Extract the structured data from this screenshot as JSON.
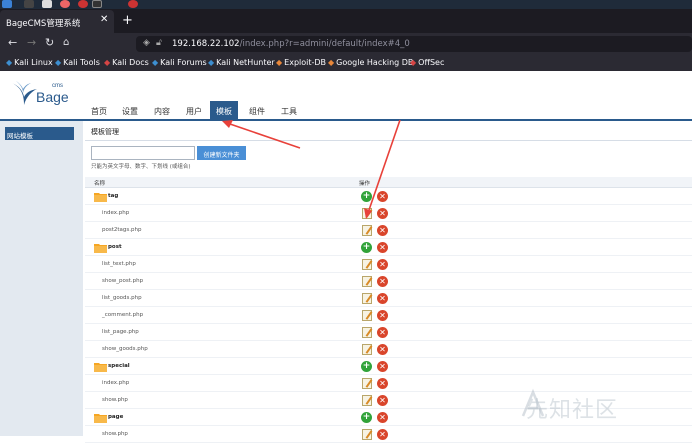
{
  "browser": {
    "tab_title": "BageCMS管理系统",
    "tab_close": "✕",
    "new_tab": "+",
    "url_host": "192.168.22.102",
    "url_path": "/index.php?r=admini/default/index#4_0",
    "bookmarks": [
      "Kali Linux",
      "Kali Tools",
      "Kali Docs",
      "Kali Forums",
      "Kali NetHunter",
      "Exploit-DB",
      "Google Hacking DB",
      "OffSec"
    ]
  },
  "site": {
    "logo_text": "Bage",
    "logo_cms": "cms",
    "nav": [
      "首页",
      "设置",
      "内容",
      "用户",
      "模板",
      "组件",
      "工具"
    ],
    "nav_active_index": 4,
    "sidebar_item": "网站模板"
  },
  "content": {
    "title": "模板管理",
    "create_button": "创建新文件夹",
    "folder_input_value": "",
    "hint": "只能为英文字母、数字、下划线 (或组合)",
    "col_name": "名称",
    "col_op": "操作",
    "rows": [
      {
        "type": "folder",
        "name": "tag"
      },
      {
        "type": "file",
        "name": "index.php"
      },
      {
        "type": "file",
        "name": "post2tags.php"
      },
      {
        "type": "folder",
        "name": "post"
      },
      {
        "type": "file",
        "name": "list_text.php"
      },
      {
        "type": "file",
        "name": "show_post.php"
      },
      {
        "type": "file",
        "name": "list_goods.php"
      },
      {
        "type": "file",
        "name": "_comment.php"
      },
      {
        "type": "file",
        "name": "list_page.php"
      },
      {
        "type": "file",
        "name": "show_goods.php"
      },
      {
        "type": "folder",
        "name": "special"
      },
      {
        "type": "file",
        "name": "index.php"
      },
      {
        "type": "file",
        "name": "show.php"
      },
      {
        "type": "folder",
        "name": "page"
      },
      {
        "type": "file",
        "name": "show.php"
      }
    ]
  },
  "watermark": "先知社区",
  "colors": {
    "accent": "#2a5a8c",
    "annotation_arrow": "#e8413a",
    "add": "#31a33a",
    "delete": "#d9452b",
    "folder": "#f6a623"
  }
}
